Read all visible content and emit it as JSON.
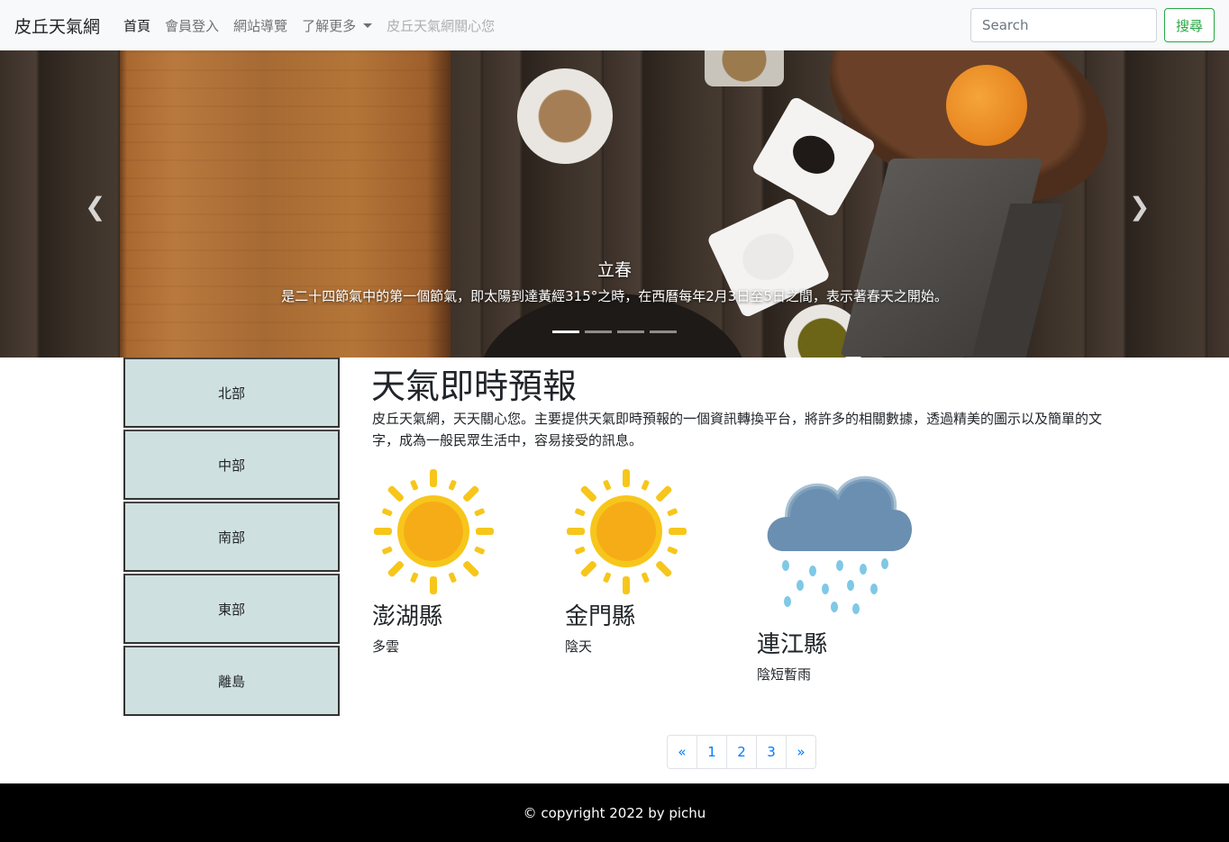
{
  "navbar": {
    "brand": "皮丘天氣網",
    "items": [
      {
        "label": "首頁"
      },
      {
        "label": "會員登入"
      },
      {
        "label": "網站導覽"
      },
      {
        "label": "了解更多"
      },
      {
        "label": "皮丘天氣網關心您"
      }
    ],
    "search_placeholder": "Search",
    "search_button": "搜尋"
  },
  "carousel": {
    "title": "立春",
    "text": "是二十四節氣中的第一個節氣，即太陽到達黃經315°之時，在西曆每年2月3日至5日之間，表示著春天之開始。",
    "prev_icon": "chevron-left-icon",
    "next_icon": "chevron-right-icon",
    "indicator_count": 4,
    "active_index": 0
  },
  "sidebar": {
    "regions": [
      {
        "label": "北部"
      },
      {
        "label": "中部"
      },
      {
        "label": "南部"
      },
      {
        "label": "東部"
      },
      {
        "label": "離島"
      }
    ]
  },
  "main": {
    "title": "天氣即時預報",
    "intro": "皮丘天氣網，天天關心您。主要提供天氣即時預報的一個資訊轉換平台，將許多的相關數據，透過精美的圖示以及簡單的文字，成為一般民眾生活中，容易接受的訊息。",
    "cards": [
      {
        "name": "澎湖縣",
        "weather": "多雲",
        "icon": "sun-icon"
      },
      {
        "name": "金門縣",
        "weather": "陰天",
        "icon": "sun-icon"
      },
      {
        "name": "連江縣",
        "weather": "陰短暫雨",
        "icon": "rain-cloud-icon"
      }
    ]
  },
  "pagination": {
    "prev": "«",
    "pages": [
      "1",
      "2",
      "3"
    ],
    "next": "»"
  },
  "footer": {
    "copyright": "© copyright 2022 by pichu"
  },
  "colors": {
    "navbar_bg": "#f8f9fa",
    "sidebar_bg": "#cfe0e0",
    "search_green": "#28a745",
    "link_blue": "#007bff",
    "footer_bg": "#000000"
  }
}
